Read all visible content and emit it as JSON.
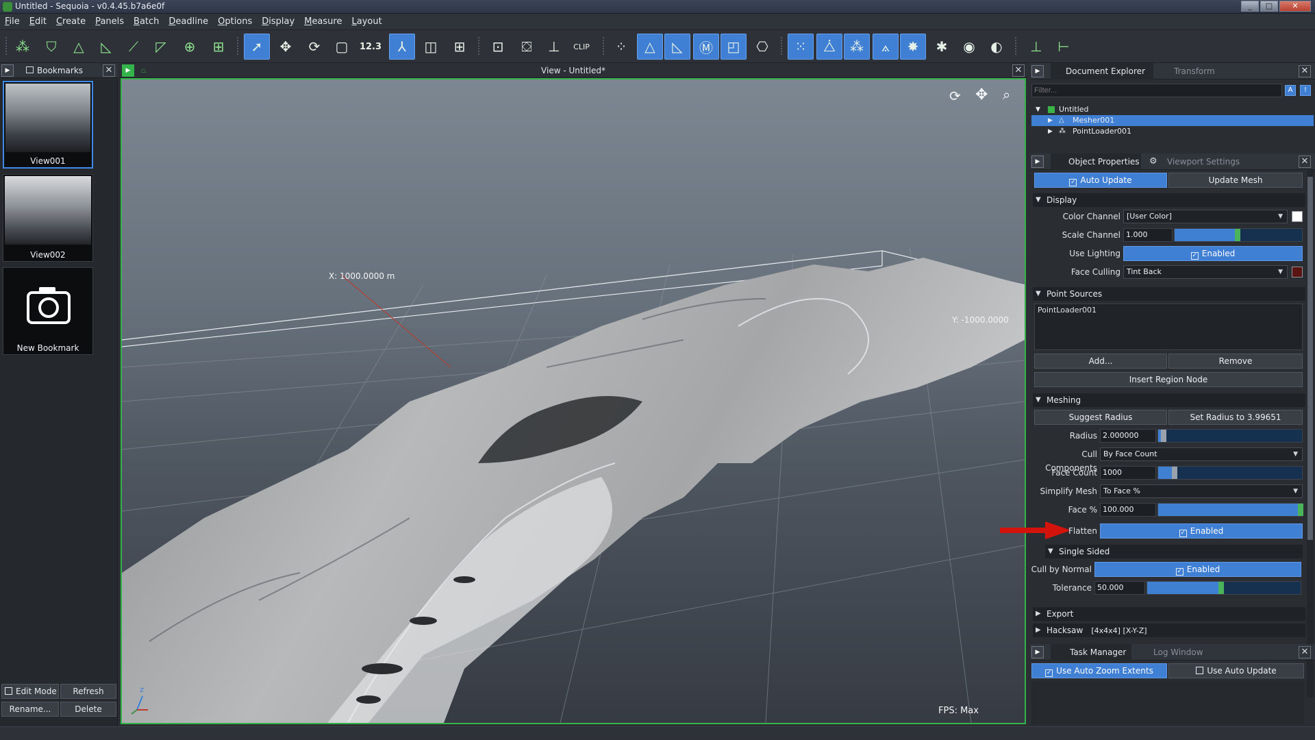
{
  "window": {
    "title": "Untitled - Sequoia - v0.4.45.b7a6e0f"
  },
  "menu": [
    "File",
    "Edit",
    "Create",
    "Panels",
    "Batch",
    "Deadline",
    "Options",
    "Display",
    "Measure",
    "Layout"
  ],
  "toolbar": {
    "num_label": "12.3",
    "clip_label": "CLIP"
  },
  "bookmarks": {
    "tab": "Bookmarks",
    "items": [
      {
        "label": "View001"
      },
      {
        "label": "View002"
      },
      {
        "label": "New Bookmark"
      }
    ],
    "edit_mode": "Edit Mode",
    "refresh": "Refresh",
    "rename": "Rename...",
    "delete": "Delete"
  },
  "viewport": {
    "title": "View - Untitled*",
    "x_label": "X: 1000.0000 m",
    "y_label": "Y: -1000.0000",
    "fps": "FPS: Max",
    "axis_z": "z"
  },
  "explorer": {
    "tab": "Document Explorer",
    "tab2": "Transform",
    "filter_placeholder": "Filter...",
    "tree": [
      "Untitled",
      "Mesher001",
      "PointLoader001"
    ]
  },
  "props": {
    "tab": "Object Properties",
    "tab2": "Viewport Settings",
    "auto_update": "Auto Update",
    "update_mesh": "Update Mesh",
    "display": {
      "header": "Display",
      "color_channel_label": "Color Channel",
      "color_channel_value": "[User Color]",
      "scale_channel_label": "Scale Channel",
      "scale_channel_value": "1.000",
      "use_lighting_label": "Use Lighting",
      "use_lighting_value": "Enabled",
      "face_culling_label": "Face Culling",
      "face_culling_value": "Tint Back"
    },
    "point_sources": {
      "header": "Point Sources",
      "item": "PointLoader001",
      "add": "Add...",
      "remove": "Remove",
      "insert": "Insert Region Node"
    },
    "meshing": {
      "header": "Meshing",
      "suggest": "Suggest Radius",
      "set_radius": "Set Radius to 3.99651",
      "radius_label": "Radius",
      "radius_value": "2.000000",
      "cull_label": "Cull Components",
      "cull_value": "By Face Count",
      "face_count_label": "Face Count",
      "face_count_value": "1000",
      "simplify_label": "Simplify Mesh",
      "simplify_value": "To Face %",
      "face_pct_label": "Face %",
      "face_pct_value": "100.000",
      "flatten_label": "Flatten",
      "flatten_value": "Enabled"
    },
    "single_sided": {
      "header": "Single Sided",
      "cull_normal_label": "Cull by Normal",
      "cull_normal_value": "Enabled",
      "tolerance_label": "Tolerance",
      "tolerance_value": "50.000"
    },
    "export_header": "Export",
    "hacksaw_header": "Hacksaw",
    "hacksaw_value": "[4x4x4] [X-Y-Z]"
  },
  "tasks": {
    "tab": "Task Manager",
    "tab2": "Log Window",
    "auto_zoom": "Use Auto Zoom Extents",
    "auto_update": "Use Auto Update"
  },
  "colors": {
    "accent": "#3f7fd4",
    "viewport_border": "#34b34a",
    "enabled_knob": "#49b45a"
  }
}
